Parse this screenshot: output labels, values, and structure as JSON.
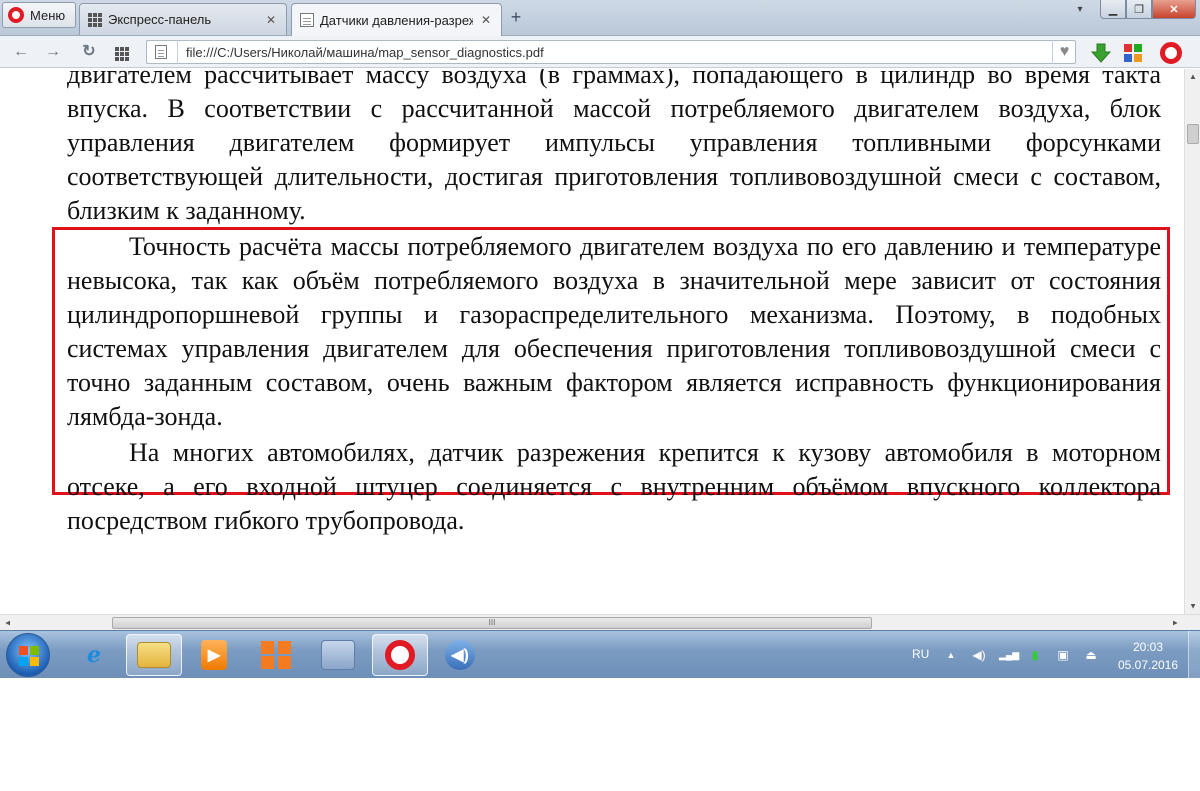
{
  "browser": {
    "menu_label": "Меню",
    "tabs": [
      {
        "label": "Экспресс-панель"
      },
      {
        "label": "Датчики давления-разреж"
      }
    ],
    "address": "file:///C:/Users/Николай/машина/map_sensor_diagnostics.pdf"
  },
  "document": {
    "paragraphs": [
      "двигателем рассчитывает массу воздуха (в граммах), попадающего в цилиндр во время такта впуска. В соответствии с рассчитанной массой потребляемого двигателем воздуха, блок управления двигателем формирует импульсы управления топливными форсунками соответствующей длительности, достигая приготовления топливовоздушной смеси с составом, близким к заданному.",
      "Точность расчёта массы потребляемого двигателем воздуха по его давлению и температуре невысока, так как объём потребляемого воздуха в значительной мере зависит от состояния цилиндропоршневой группы и газораспределительного механизма. Поэтому, в подобных системах управления двигателем для обеспечения приготовления топливовоздушной смеси с точно заданным составом, очень важным фактором является исправность функционирования лямбда-зонда.",
      "На многих автомобилях, датчик разрежения крепится к кузову автомобиля в моторном отсеке, а его входной штуцер соединяется с внутренним объёмом впускного коллектора посредством гибкого трубопровода."
    ],
    "highlight_color": "#e0101c"
  },
  "taskbar": {
    "language": "RU",
    "time": "20:03",
    "date": "05.07.2016"
  },
  "icons": {
    "back": "←",
    "forward": "→",
    "reload": "↻",
    "heart": "♥",
    "close": "✕",
    "plus": "+",
    "minimize": "▁",
    "restore": "❐",
    "tabs_menu": "▾",
    "scroll_grip": "III",
    "media": "▶",
    "speaker": "◀)",
    "tray_up": "▲",
    "tray_volume": "◀)",
    "tray_signal": "▂▄▆",
    "tray_battery": "▮",
    "tray_network": "▣",
    "tray_safe_remove": "⏏"
  }
}
